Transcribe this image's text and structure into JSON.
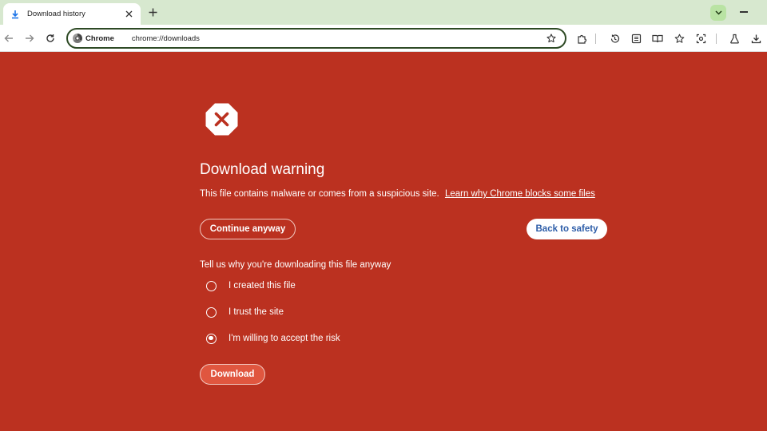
{
  "tabs": [
    {
      "title": "Download history",
      "icon": "download-icon"
    }
  ],
  "toolbar": {
    "chip_label": "Chrome",
    "url": "chrome://downloads"
  },
  "colors": {
    "tab_strip": "#D7E8CF",
    "page_background": "#BB3120",
    "safety_button_text": "#2D5DA8",
    "download_button": "#E0563F"
  },
  "warning": {
    "icon": "error-octagon-icon",
    "heading": "Download warning",
    "description": "This file contains malware or comes from a suspicious site.",
    "learn_link": "Learn why Chrome blocks some files",
    "continue_label": "Continue anyway",
    "safety_label": "Back to safety",
    "reason_title": "Tell us why you're downloading this file anyway",
    "options": [
      {
        "label": "I created this file",
        "selected": false
      },
      {
        "label": "I trust the site",
        "selected": false
      },
      {
        "label": "I'm willing to accept the risk",
        "selected": true
      }
    ],
    "download_label": "Download"
  }
}
